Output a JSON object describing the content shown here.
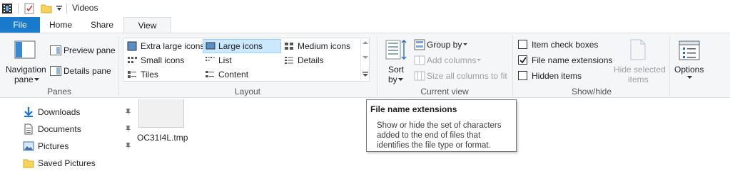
{
  "window": {
    "title": "Videos"
  },
  "tabs": {
    "file": "File",
    "home": "Home",
    "share": "Share",
    "view": "View"
  },
  "panes": {
    "navigation_pane": "Navigation",
    "navigation_pane_2": "pane",
    "preview_pane": "Preview pane",
    "details_pane": "Details pane",
    "group_label": "Panes"
  },
  "layout": {
    "items": {
      "extra_large": "Extra large icons",
      "large": "Large icons",
      "medium": "Medium icons",
      "small": "Small icons",
      "list": "List",
      "details": "Details",
      "tiles": "Tiles",
      "content": "Content"
    },
    "selected": "Large icons",
    "group_label": "Layout"
  },
  "current_view": {
    "sort_by": "Sort",
    "sort_by_2": "by",
    "group_by": "Group by",
    "add_columns": "Add columns",
    "size_all_columns": "Size all columns to fit",
    "group_label": "Current view"
  },
  "show_hide": {
    "item_check_boxes": "Item check boxes",
    "item_check_boxes_checked": false,
    "file_name_extensions": "File name extensions",
    "file_name_extensions_checked": true,
    "hidden_items": "Hidden items",
    "hidden_items_checked": false,
    "hide_selected_items": "Hide selected",
    "hide_selected_items_2": "items",
    "group_label": "Show/hide"
  },
  "options": {
    "label": "Options"
  },
  "nav_tree": [
    {
      "label": "Downloads",
      "icon": "download-icon",
      "pinned": true
    },
    {
      "label": "Documents",
      "icon": "documents-icon",
      "pinned": true
    },
    {
      "label": "Pictures",
      "icon": "pictures-icon",
      "pinned": true
    },
    {
      "label": "Saved Pictures",
      "icon": "folder-icon",
      "pinned": false
    }
  ],
  "files": [
    {
      "name": "OC31I4L.tmp"
    }
  ],
  "tooltip": {
    "title": "File name extensions",
    "body": "Show or hide the set of characters added to the end of files that identifies the file type or format."
  },
  "colors": {
    "accent": "#1979ca",
    "selected_bg": "#cce8ff",
    "ribbon_bg": "#f5f6f7"
  }
}
